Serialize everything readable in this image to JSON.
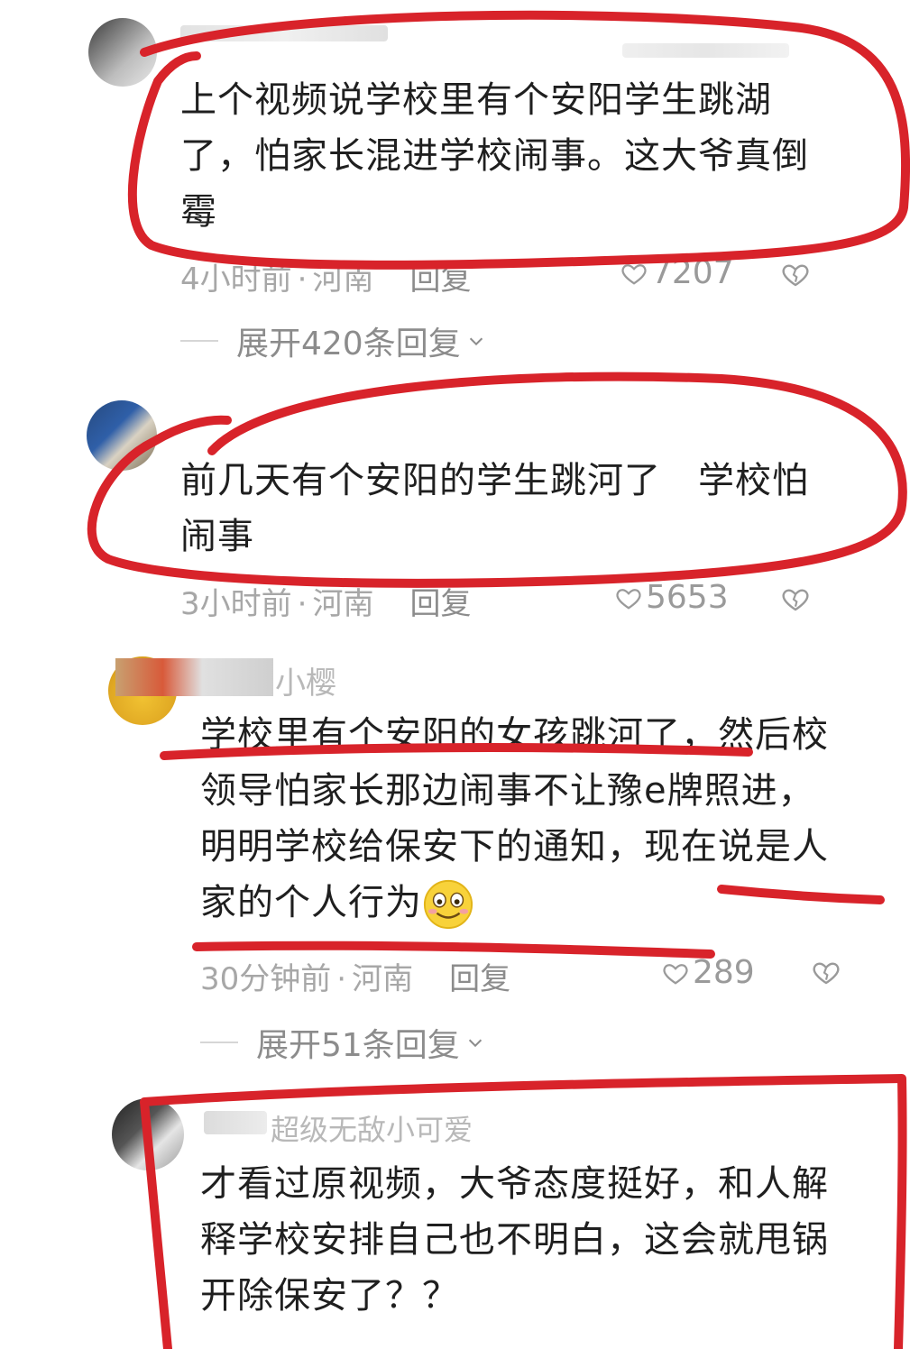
{
  "comments": [
    {
      "username": "",
      "content": "上个视频说学校里有个安阳学生跳湖了，怕家长混进学校闹事。这大爷真倒霉",
      "time": "4小时前",
      "location": "河南",
      "reply_label": "回复",
      "likes": "7207",
      "expand_label": "展开420条回复"
    },
    {
      "username": "",
      "content": "前几天有个安阳的学生跳河了　学校怕闹事",
      "time": "3小时前",
      "location": "河南",
      "reply_label": "回复",
      "likes": "5653"
    },
    {
      "username": "小樱",
      "content": "学校里有个安阳的女孩跳河了，然后校领导怕家长那边闹事不让豫e牌照进，明明学校给保安下的通知，现在说是人家的个人行为",
      "time": "30分钟前",
      "location": "河南",
      "reply_label": "回复",
      "likes": "289",
      "expand_label": "展开51条回复"
    },
    {
      "username": "超级无敌小可爱",
      "content": "才看过原视频，大爷态度挺好，和人解释学校安排自己也不明白，这会就甩锅开除保安了？？"
    }
  ],
  "icons": {
    "like": "heart-icon",
    "dislike": "broken-heart-icon",
    "expand": "chevron-down-icon",
    "emoji": "smile-emoji"
  },
  "colors": {
    "annotation": "#d8232a",
    "text": "#1f1f1f",
    "meta": "#a7a7a7"
  }
}
